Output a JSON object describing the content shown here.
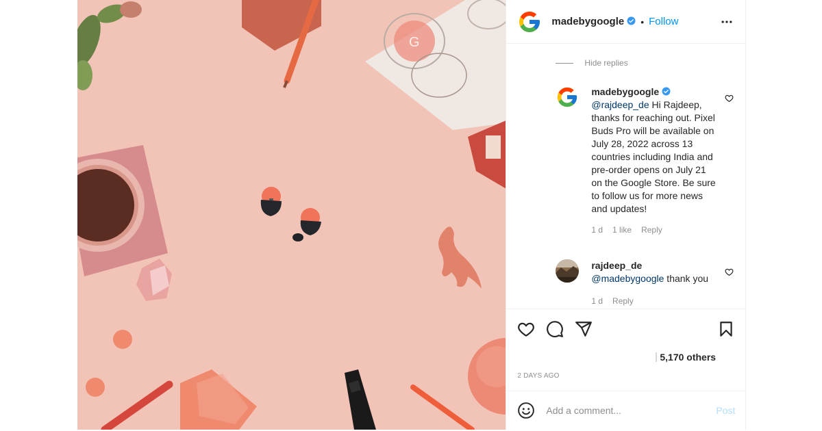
{
  "header": {
    "username": "madebygoogle",
    "separator": "•",
    "follow_label": "Follow"
  },
  "comments": {
    "hide_replies_label": "Hide replies",
    "replies": [
      {
        "username": "madebygoogle",
        "mention": "@rajdeep_de",
        "text": " Hi Rajdeep, thanks for reaching out. Pixel Buds Pro will be available on July 28, 2022 across 13 countries including India and pre-order opens on July 21 on the Google Store. Be sure to follow us for more news and updates!",
        "age": "1 d",
        "likes": "1 like",
        "reply_label": "Reply"
      },
      {
        "username": "rajdeep_de",
        "mention": "@madebygoogle",
        "text": " thank you",
        "age": "1 d",
        "reply_label": "Reply"
      }
    ]
  },
  "likes": {
    "text": "5,170 others"
  },
  "timestamp": "2 DAYS AGO",
  "add_comment": {
    "placeholder": "Add a comment...",
    "post_label": "Post"
  },
  "colors": {
    "photo_background": "#f2c4b8",
    "follow_blue": "#0095f6",
    "mention_blue": "#00376b",
    "post_disabled": "#b2dffc",
    "verified_blue": "#3897f0",
    "muted_gray": "#8e8e8e"
  },
  "icons": {
    "header": [
      "google-logo-icon",
      "verified-badge-icon",
      "more-options-icon"
    ],
    "actions": [
      "like-heart-icon",
      "comment-bubble-icon",
      "share-paper-plane-icon",
      "save-bookmark-icon"
    ],
    "composer": [
      "emoji-smiley-icon"
    ]
  }
}
